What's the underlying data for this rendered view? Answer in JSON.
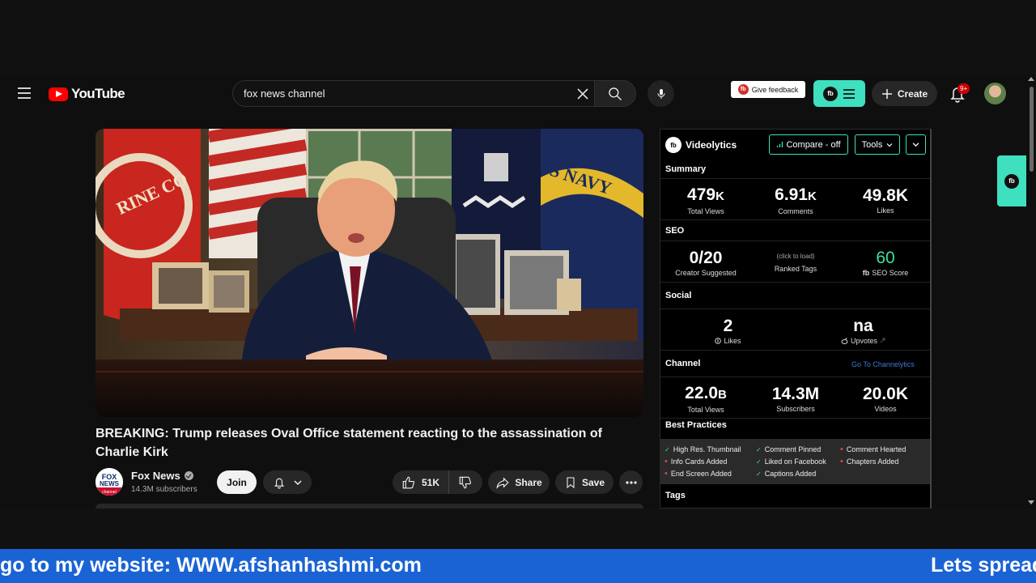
{
  "header": {
    "logo_text": "YouTube",
    "search_value": "fox news channel",
    "feedback_label": "Give feedback",
    "feedback_badge": "fb",
    "create_label": "Create",
    "notifications_count": "9+"
  },
  "video": {
    "title": "BREAKING: Trump releases Oval Office statement reacting to the assassination of Charlie Kirk",
    "flag_text_left": "RINE CO",
    "flag_text_right": "S NAVY"
  },
  "channel": {
    "logo_text_top": "FOX",
    "logo_text_mid": "NEWS",
    "logo_text_bot": "channel",
    "name": "Fox News",
    "subscribers": "14.3M subscribers",
    "join_label": "Join"
  },
  "actions": {
    "likes": "51K",
    "share_label": "Share",
    "save_label": "Save"
  },
  "videolytics": {
    "brand": "Videolytics",
    "logo": "fb",
    "compare_label": "Compare - off",
    "tools_label": "Tools",
    "summary_title": "Summary",
    "summary": {
      "views": "479",
      "views_unit": "K",
      "views_label": "Total Views",
      "comments": "6.91",
      "comments_unit": "K",
      "comments_label": "Comments",
      "likes": "49.8K",
      "likes_label": "Likes"
    },
    "seo_title": "SEO",
    "seo": {
      "creator_suggested": "0/20",
      "creator_suggested_label": "Creator Suggested",
      "ranked_tags_hint": "(click to load)",
      "ranked_tags_label": "Ranked Tags",
      "score": "60",
      "score_label": "SEO Score"
    },
    "social_title": "Social",
    "social": {
      "likes": "2",
      "likes_label": "Likes",
      "upvotes": "na",
      "upvotes_label": "Upvotes"
    },
    "channel_title": "Channel",
    "channel_link": "Go To Channelytics",
    "channel": {
      "views": "22.0",
      "views_unit": "B",
      "views_label": "Total Views",
      "subscribers": "14.3M",
      "subscribers_label": "Subscribers",
      "videos": "20.0K",
      "videos_label": "Videos"
    },
    "best_practices_title": "Best Practices",
    "best_practices": [
      {
        "label": "High Res. Thumbnail",
        "ok": true
      },
      {
        "label": "Comment Pinned",
        "ok": true
      },
      {
        "label": "Comment Hearted",
        "ok": false
      },
      {
        "label": "Info Cards Added",
        "ok": false
      },
      {
        "label": "Liked on Facebook",
        "ok": true
      },
      {
        "label": "Chapters Added",
        "ok": false
      },
      {
        "label": "End Screen Added",
        "ok": false
      },
      {
        "label": "Captions Added",
        "ok": true
      }
    ],
    "tags_title": "Tags",
    "side_tab_logo": "fb"
  },
  "ticker": {
    "left_text": "go to my website: WWW.afshanhashmi.com",
    "right_text": "Lets spread"
  },
  "colors": {
    "accent": "#3ee0c0",
    "youtube_red": "#ff0000",
    "ticker_blue": "#1a63d4",
    "seo_score": "#3ee0a0",
    "link": "#3e7bd6"
  }
}
